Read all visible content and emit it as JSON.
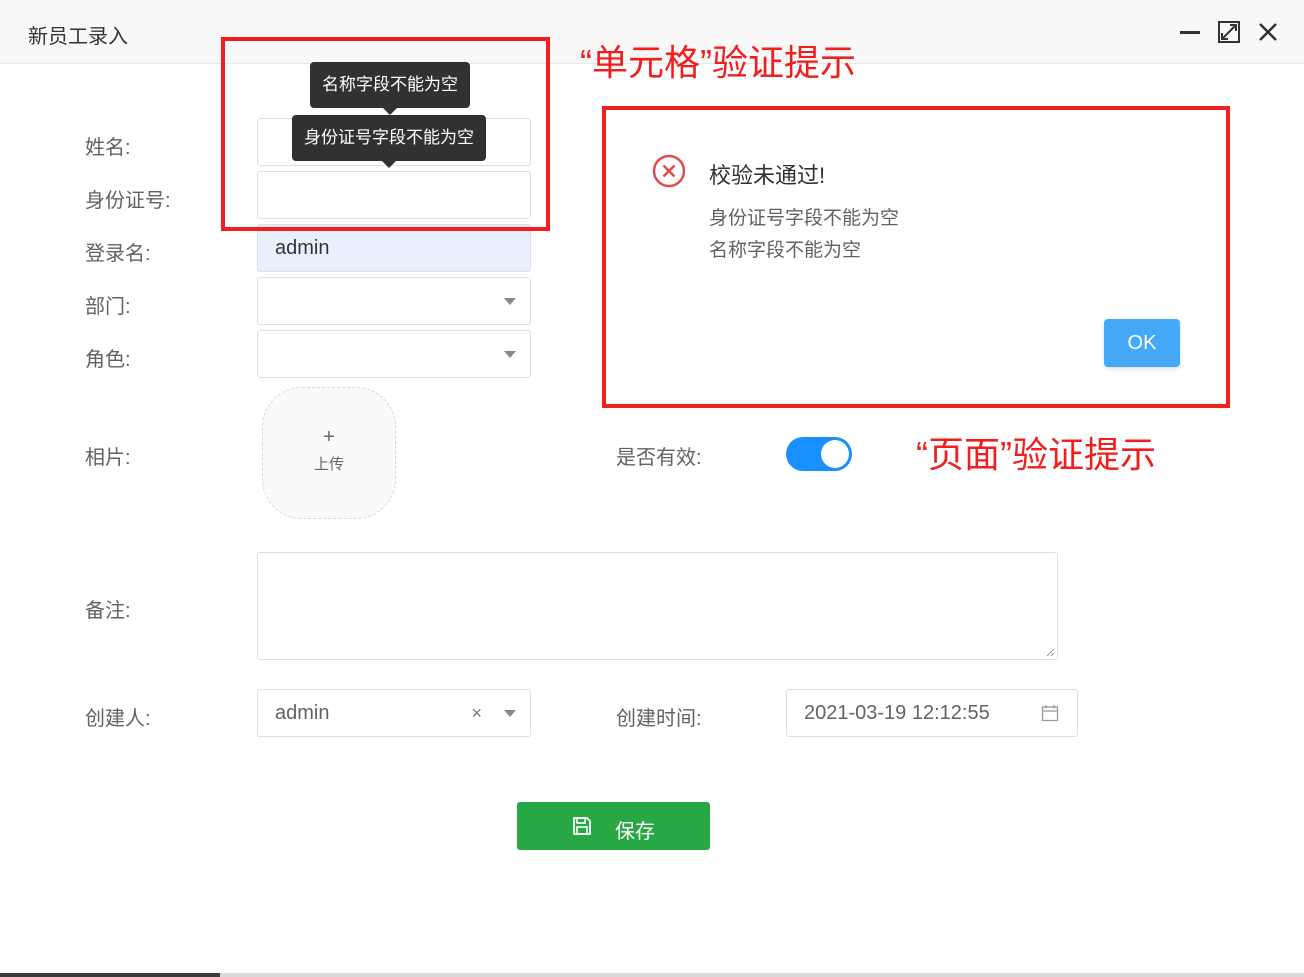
{
  "window": {
    "title": "新员工录入"
  },
  "form": {
    "name_label": "姓名:",
    "id_label": "身份证号:",
    "login_label": "登录名:",
    "login_value": "admin",
    "dept_label": "部门:",
    "role_label": "角色:",
    "photo_label": "相片:",
    "upload_plus": "+",
    "upload_text": "上传",
    "active_label": "是否有效:",
    "active_value": true,
    "remark_label": "备注:",
    "creator_label": "创建人:",
    "creator_value": "admin",
    "creator_clear": "×",
    "created_time_label": "创建时间:",
    "created_time_value": "2021-03-19 12:12:55",
    "save_label": "保存"
  },
  "tooltips": {
    "name_error": "名称字段不能为空",
    "id_error": "身份证号字段不能为空"
  },
  "dialog": {
    "title": "校验未通过!",
    "messages": [
      "身份证号字段不能为空",
      "名称字段不能为空"
    ],
    "ok_label": "OK"
  },
  "annotations": {
    "cell_validation": "“单元格”验证提示",
    "page_validation": "“页面”验证提示"
  },
  "colors": {
    "annotation_red": "#f21d1d",
    "switch_blue": "#1890ff",
    "save_green": "#28a745",
    "ok_blue": "#45a9f7",
    "error_icon_red": "#e5484d"
  }
}
